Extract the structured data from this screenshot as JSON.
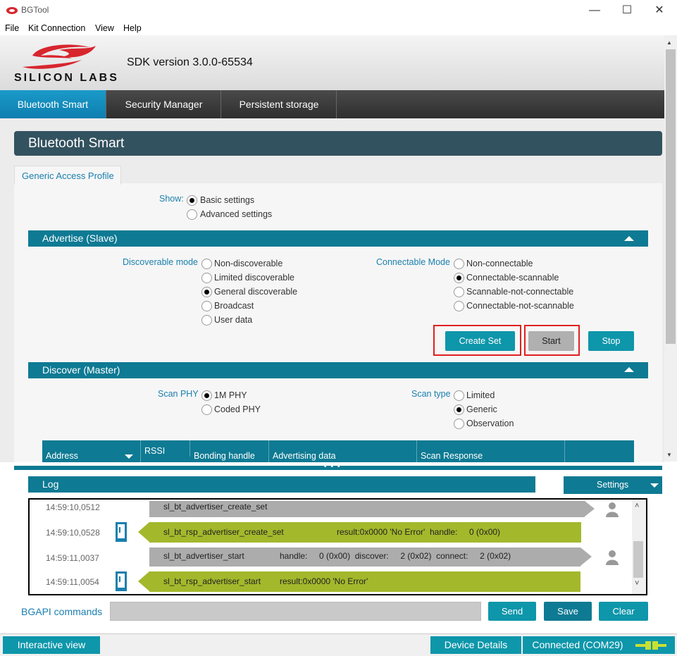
{
  "window": {
    "title": "BGTool",
    "controls": {
      "minimize": "—",
      "maximize": "☐",
      "close": "✕"
    }
  },
  "menu": [
    "File",
    "Kit Connection",
    "View",
    "Help"
  ],
  "header": {
    "logo_text": "SILICON LABS",
    "sdk_version": "SDK version 3.0.0-65534"
  },
  "tabs": [
    {
      "label": "Bluetooth Smart",
      "active": true
    },
    {
      "label": "Security Manager",
      "active": false
    },
    {
      "label": "Persistent storage",
      "active": false
    }
  ],
  "section_title": "Bluetooth Smart",
  "subtab": "Generic Access Profile",
  "show": {
    "label": "Show:",
    "options": [
      {
        "label": "Basic settings",
        "selected": true
      },
      {
        "label": "Advanced settings",
        "selected": false
      }
    ]
  },
  "advertise": {
    "title": "Advertise (Slave)",
    "discoverable_label": "Discoverable mode",
    "discoverable_options": [
      {
        "label": "Non-discoverable",
        "selected": false
      },
      {
        "label": "Limited discoverable",
        "selected": false
      },
      {
        "label": "General discoverable",
        "selected": true
      },
      {
        "label": "Broadcast",
        "selected": false
      },
      {
        "label": "User data",
        "selected": false
      }
    ],
    "connectable_label": "Connectable Mode",
    "connectable_options": [
      {
        "label": "Non-connectable",
        "selected": false
      },
      {
        "label": "Connectable-scannable",
        "selected": true
      },
      {
        "label": "Scannable-not-connectable",
        "selected": false
      },
      {
        "label": "Connectable-not-scannable",
        "selected": false
      }
    ],
    "buttons": {
      "create_set": "Create Set",
      "start": "Start",
      "stop": "Stop"
    }
  },
  "discover": {
    "title": "Discover (Master)",
    "scan_phy_label": "Scan PHY",
    "scan_phy_options": [
      {
        "label": "1M PHY",
        "selected": true
      },
      {
        "label": "Coded PHY",
        "selected": false
      }
    ],
    "scan_type_label": "Scan type",
    "scan_type_options": [
      {
        "label": "Limited",
        "selected": false
      },
      {
        "label": "Generic",
        "selected": true
      },
      {
        "label": "Observation",
        "selected": false
      }
    ],
    "table_columns": [
      "Address",
      "RSSI (dBm)",
      "Bonding handle",
      "Advertising data",
      "Scan Response",
      ""
    ]
  },
  "log": {
    "title": "Log",
    "settings_label": "Settings",
    "entries": [
      {
        "time": "14:59:10,0512",
        "type": "cmd",
        "name": "sl_bt_advertiser_create_set",
        "params": ""
      },
      {
        "time": "14:59:10,0528",
        "type": "rsp",
        "name": "sl_bt_rsp_advertiser_create_set",
        "params": "result:0x0000 'No Error'  handle:     0 (0x00)"
      },
      {
        "time": "14:59:11,0037",
        "type": "cmd",
        "name": "sl_bt_advertiser_start",
        "params": "handle:     0 (0x00)  discover:     2 (0x02)  connect:     2 (0x02)"
      },
      {
        "time": "14:59:11,0054",
        "type": "rsp",
        "name": "sl_bt_rsp_advertiser_start",
        "params": "result:0x0000 'No Error'"
      }
    ]
  },
  "bgapi": {
    "label": "BGAPI commands",
    "input_value": "",
    "send": "Send",
    "save": "Save",
    "clear": "Clear"
  },
  "statusbar": {
    "interactive_view": "Interactive view",
    "device_details": "Device Details",
    "connection": "Connected (COM29)"
  },
  "colors": {
    "accent_teal": "#0e96aa",
    "section_teal": "#0e7a93",
    "title_bar": "#33525f",
    "response_green": "#a4b82c",
    "command_gray": "#acacac",
    "highlight_red": "#e02020",
    "logo_red": "#d7262e"
  }
}
